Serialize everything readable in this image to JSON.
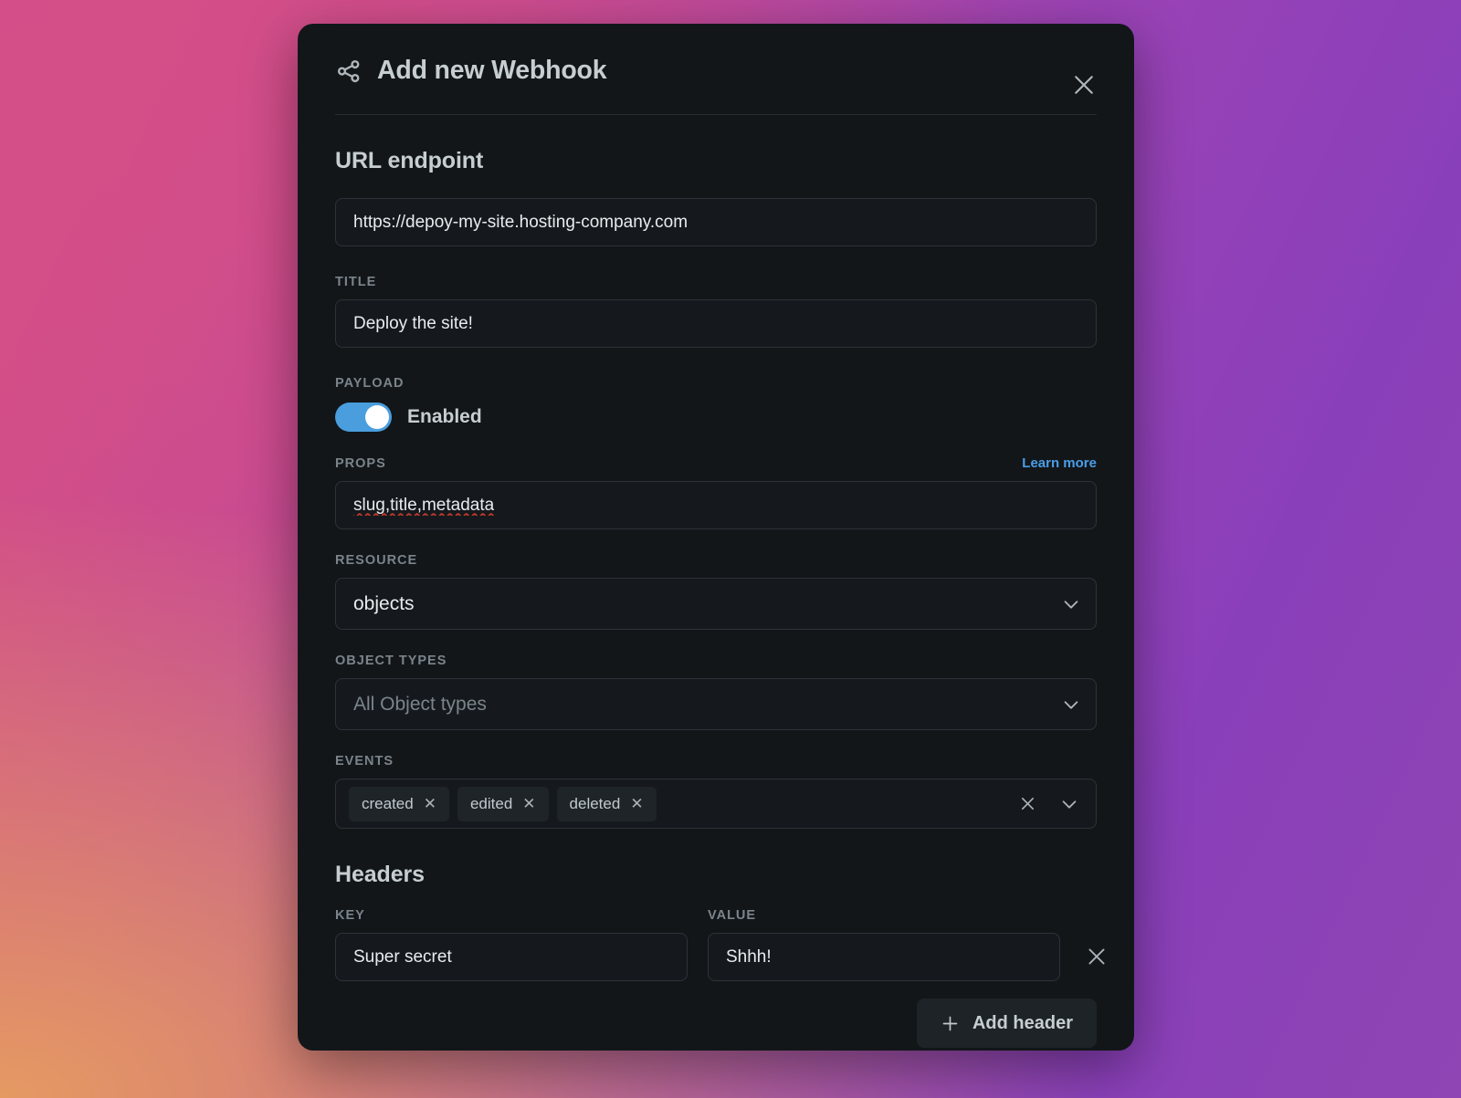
{
  "theme": {
    "modal_bg": "#121619",
    "input_bg": "#15191d",
    "input_border": "#2c3338",
    "text_primary": "#e8ecef",
    "text_heading": "#c7ced2",
    "text_muted": "#7b848b",
    "accent_blue": "#4a9ede",
    "link_blue": "#4a9ee8",
    "chip_bg": "#1e2428",
    "spellcheck_red": "#c0392b"
  },
  "modal": {
    "title": "Add new Webhook",
    "icon": "share-icon",
    "close_icon": "close-icon"
  },
  "url_section": {
    "heading": "URL endpoint",
    "url_value": "https://depoy-my-site.hosting-company.com",
    "title_label": "TITLE",
    "title_value": "Deploy the site!"
  },
  "payload_section": {
    "label": "PAYLOAD",
    "toggle_state": "Enabled",
    "toggle_on": true,
    "props_label": "PROPS",
    "learn_more": "Learn more",
    "props_value": "slug,title,metadata",
    "props_misspelled": true,
    "resource_label": "RESOURCE",
    "resource_value": "objects",
    "object_types_label": "OBJECT TYPES",
    "object_types_placeholder": "All Object types",
    "events_label": "EVENTS",
    "events": [
      {
        "label": "created",
        "remove_icon": "chip-close-icon"
      },
      {
        "label": "edited",
        "remove_icon": "chip-close-icon"
      },
      {
        "label": "deleted",
        "remove_icon": "chip-close-icon"
      }
    ],
    "events_clear_icon": "clear-all-icon",
    "events_chevron_icon": "chevron-down-icon"
  },
  "headers_section": {
    "heading": "Headers",
    "key_label": "KEY",
    "value_label": "VALUE",
    "rows": [
      {
        "key": "Super secret",
        "value": "Shhh!",
        "remove_icon": "remove-row-icon"
      }
    ],
    "add_button_label": "Add header",
    "add_button_icon": "plus-icon"
  }
}
